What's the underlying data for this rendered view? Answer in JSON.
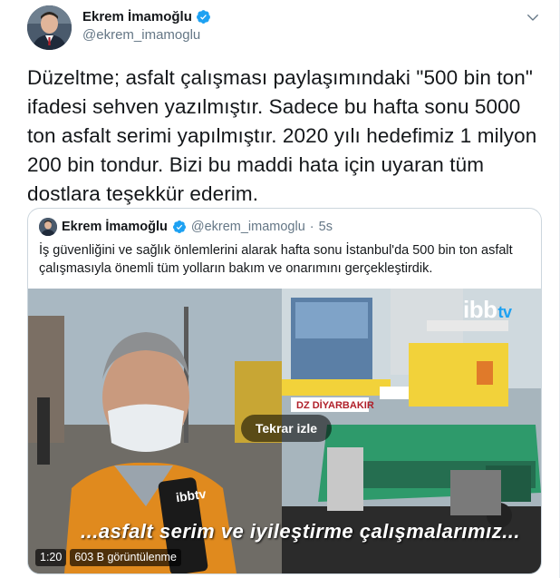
{
  "tweet": {
    "author": {
      "display_name": "Ekrem İmamoğlu",
      "handle": "@ekrem_imamoglu",
      "verified": true
    },
    "text": "Düzeltme; asfalt çalışması paylaşımındaki \"500 bin ton\" ifadesi sehven yazılmıştır. Sadece bu hafta sonu 5000 ton asfalt serimi yapılmıştır. 2020 yılı hedefimiz 1 milyon 200 bin tondur. Bizi bu maddi hata için uyaran tüm dostlara teşekkür ederim."
  },
  "quote": {
    "author": {
      "display_name": "Ekrem İmamoğlu",
      "handle": "@ekrem_imamoglu",
      "separator": "·",
      "time": "5s",
      "verified": true
    },
    "text": "İş güvenliğini ve sağlık önlemlerini alarak hafta sonu İstanbul'da 500 bin ton asfalt çalışmasıyla önemli tüm yolların bakım ve onarımını gerçekleştirdik.",
    "video": {
      "replay_label": "Tekrar izle",
      "caption": "...asfalt serim ve iyileştirme çalışmalarımız...",
      "brand": "ibb",
      "brand_suffix": "tv",
      "mic_brand": "ibbtv",
      "duration": "1:20",
      "views": "603 B görüntülenme",
      "sign_text": "DZ DİYARBAKIR"
    }
  },
  "icons": {
    "verified": "verified-badge-icon",
    "more": "chevron-down-icon"
  },
  "colors": {
    "verified_blue": "#1da1f2",
    "text_primary": "#14171a",
    "text_secondary": "#657786",
    "border": "#ccd6dd"
  }
}
